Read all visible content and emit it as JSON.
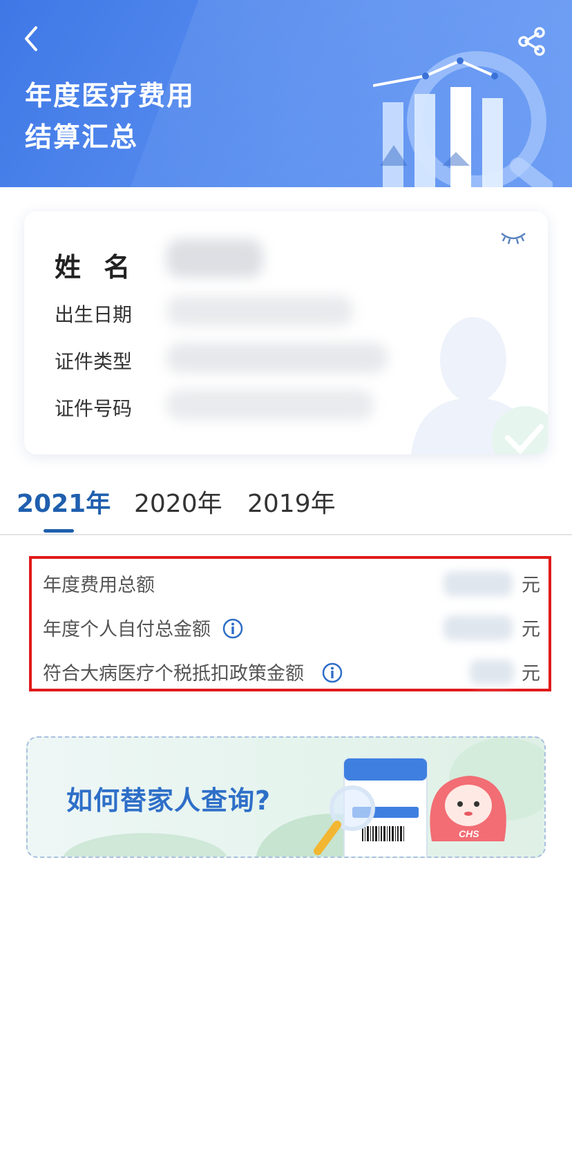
{
  "header": {
    "title_line1": "年度医疗费用",
    "title_line2": "结算汇总",
    "back_icon": "chevron-left-icon",
    "share_icon": "share-icon"
  },
  "info_card": {
    "name_label": "姓 名",
    "birth_label": "出生日期",
    "id_type_label": "证件类型",
    "id_number_label": "证件号码",
    "visibility_icon": "eye-closed-icon"
  },
  "tabs": [
    {
      "label": "2021年",
      "active": true
    },
    {
      "label": "2020年",
      "active": false
    },
    {
      "label": "2019年",
      "active": false
    }
  ],
  "summary": {
    "rows": [
      {
        "label": "年度费用总额",
        "unit": "元",
        "has_info": false
      },
      {
        "label": "年度个人自付总金额",
        "unit": "元",
        "has_info": true
      },
      {
        "label": "符合大病医疗个税抵扣政策金额",
        "unit": "元",
        "has_info": true
      }
    ]
  },
  "banner": {
    "text": "如何替家人查询?",
    "mascot_text": "CHS"
  },
  "colors": {
    "header_blue": "#4a82ea",
    "active_tab": "#1f5fae",
    "highlight_border": "#e01a1a",
    "banner_text": "#2e6fc8"
  }
}
